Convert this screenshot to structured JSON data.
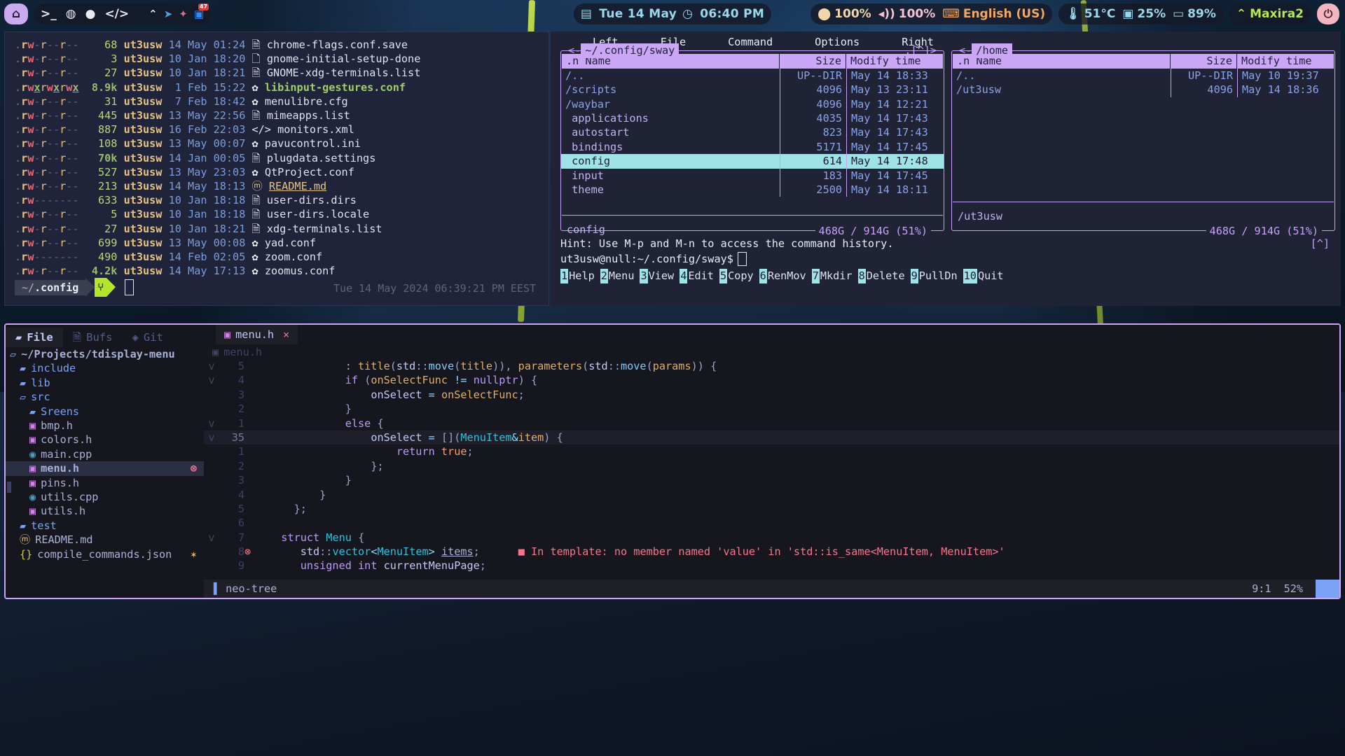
{
  "topbar": {
    "home_icon": "home-icon",
    "launchers": [
      "terminal-icon",
      "browser-icon",
      "chat-icon",
      "code-icon"
    ],
    "tray": [
      "wifi-icon",
      "telegram-icon",
      "bluetooth-icon",
      "zoom-icon"
    ],
    "zoom_badge": "47",
    "clock": {
      "calendar_icon": "calendar-icon",
      "date": "Tue 14 May",
      "clock_icon": "clock-icon",
      "time": "06:40 PM"
    },
    "stats": [
      {
        "name": "brightness",
        "icon": "sun-icon",
        "value": "100%",
        "color": "#f0d6a8"
      },
      {
        "name": "volume",
        "icon": "speaker-icon",
        "value": "100%",
        "color": "#f5c2d2"
      },
      {
        "name": "keyboard-layout",
        "icon": "keyboard-icon",
        "value": "English (US)",
        "color": "#f0a868"
      },
      {
        "name": "temperature",
        "icon": "thermometer-icon",
        "value": "51°C",
        "color": "#9ad7ea"
      },
      {
        "name": "cpu",
        "icon": "cpu-icon",
        "value": "25%",
        "color": "#9ad7ea"
      },
      {
        "name": "battery",
        "icon": "battery-icon",
        "value": "89%",
        "color": "#9ad7ea"
      },
      {
        "name": "network",
        "icon": "wifi-icon",
        "value": "Maxira2",
        "color": "#b5e853"
      }
    ],
    "power_icon": "power-icon"
  },
  "terminal": {
    "prompt_path": "~/.config",
    "prompt_symbol": "⑂",
    "timestamp": "Tue 14 May 2024 06:39:21 PM EEST",
    "files": [
      {
        "perm": ".rw-r--r--",
        "size": "68",
        "size_bold": false,
        "owner": "ut3usw",
        "day": "14",
        "mon": "May",
        "time": "01:24",
        "icon": "file-icon",
        "name": "chrome-flags.conf.save",
        "style": "plain"
      },
      {
        "perm": ".rw-r--r--",
        "size": "3",
        "size_bold": false,
        "owner": "ut3usw",
        "day": "10",
        "mon": "Jan",
        "time": "18:20",
        "icon": "file-outline-icon",
        "name": "gnome-initial-setup-done",
        "style": "plain"
      },
      {
        "perm": ".rw-r--r--",
        "size": "27",
        "size_bold": false,
        "owner": "ut3usw",
        "day": "10",
        "mon": "Jan",
        "time": "18:21",
        "icon": "file-icon",
        "name": "GNOME-xdg-terminals.list",
        "style": "plain"
      },
      {
        "perm": ".rwxrwxrwx",
        "size": "8.9k",
        "size_bold": true,
        "owner": "ut3usw",
        "day": "1",
        "mon": "Feb",
        "time": "15:22",
        "icon": "gear-icon",
        "name": "libinput-gestures.conf",
        "style": "exec"
      },
      {
        "perm": ".rw-r--r--",
        "size": "31",
        "size_bold": false,
        "owner": "ut3usw",
        "day": "7",
        "mon": "Feb",
        "time": "18:42",
        "icon": "gear-icon",
        "name": "menulibre.cfg",
        "style": "plain"
      },
      {
        "perm": ".rw-r--r--",
        "size": "445",
        "size_bold": false,
        "owner": "ut3usw",
        "day": "13",
        "mon": "May",
        "time": "22:56",
        "icon": "file-icon",
        "name": "mimeapps.list",
        "style": "plain"
      },
      {
        "perm": ".rw-r--r--",
        "size": "887",
        "size_bold": false,
        "owner": "ut3usw",
        "day": "16",
        "mon": "Feb",
        "time": "22:03",
        "icon": "code-file-icon",
        "name": "monitors.xml",
        "style": "plain"
      },
      {
        "perm": ".rw-r--r--",
        "size": "108",
        "size_bold": false,
        "owner": "ut3usw",
        "day": "13",
        "mon": "May",
        "time": "00:07",
        "icon": "gear-icon",
        "name": "pavucontrol.ini",
        "style": "plain"
      },
      {
        "perm": ".rw-r--r--",
        "size": "70k",
        "size_bold": true,
        "owner": "ut3usw",
        "day": "14",
        "mon": "Jan",
        "time": "00:05",
        "icon": "file-icon",
        "name": "plugdata.settings",
        "style": "plain"
      },
      {
        "perm": ".rw-r--r--",
        "size": "527",
        "size_bold": false,
        "owner": "ut3usw",
        "day": "13",
        "mon": "May",
        "time": "23:03",
        "icon": "gear-icon",
        "name": "QtProject.conf",
        "style": "plain"
      },
      {
        "perm": ".rw-r--r--",
        "size": "213",
        "size_bold": false,
        "owner": "ut3usw",
        "day": "14",
        "mon": "May",
        "time": "18:13",
        "icon": "markdown-icon",
        "name": "README.md",
        "style": "md"
      },
      {
        "perm": ".rw-------",
        "size": "633",
        "size_bold": false,
        "owner": "ut3usw",
        "day": "10",
        "mon": "Jan",
        "time": "18:18",
        "icon": "file-icon",
        "name": "user-dirs.dirs",
        "style": "plain"
      },
      {
        "perm": ".rw-r--r--",
        "size": "5",
        "size_bold": false,
        "owner": "ut3usw",
        "day": "10",
        "mon": "Jan",
        "time": "18:18",
        "icon": "file-icon",
        "name": "user-dirs.locale",
        "style": "plain"
      },
      {
        "perm": ".rw-r--r--",
        "size": "27",
        "size_bold": false,
        "owner": "ut3usw",
        "day": "10",
        "mon": "Jan",
        "time": "18:21",
        "icon": "file-icon",
        "name": "xdg-terminals.list",
        "style": "plain"
      },
      {
        "perm": ".rw-r--r--",
        "size": "699",
        "size_bold": false,
        "owner": "ut3usw",
        "day": "13",
        "mon": "May",
        "time": "00:08",
        "icon": "gear-icon",
        "name": "yad.conf",
        "style": "plain"
      },
      {
        "perm": ".rw-------",
        "size": "490",
        "size_bold": false,
        "owner": "ut3usw",
        "day": "14",
        "mon": "Feb",
        "time": "02:05",
        "icon": "gear-icon",
        "name": "zoom.conf",
        "style": "plain"
      },
      {
        "perm": ".rw-r--r--",
        "size": "4.2k",
        "size_bold": true,
        "owner": "ut3usw",
        "day": "14",
        "mon": "May",
        "time": "17:13",
        "icon": "gear-icon",
        "name": "zoomus.conf",
        "style": "plain"
      }
    ]
  },
  "mc": {
    "menu": [
      "Left",
      "File",
      "Command",
      "Options",
      "Right"
    ],
    "left_panel": {
      "path": "~/.config/sway",
      "corner_left": "<-",
      "corner_right": ".[^]>",
      "columns": {
        "name": ".n      Name",
        "size": "Size",
        "time": "Modify time"
      },
      "rows": [
        {
          "name": "/..",
          "size": "UP--DIR",
          "time": "May 14 18:33",
          "dir": true,
          "selected": false
        },
        {
          "name": "/scripts",
          "size": "4096",
          "time": "May 13 23:11",
          "dir": true,
          "selected": false
        },
        {
          "name": "/waybar",
          "size": "4096",
          "time": "May 14 12:21",
          "dir": true,
          "selected": false
        },
        {
          "name": " applications",
          "size": "4035",
          "time": "May 14 17:43",
          "dir": false,
          "selected": false
        },
        {
          "name": " autostart",
          "size": "823",
          "time": "May 14 17:43",
          "dir": false,
          "selected": false
        },
        {
          "name": " bindings",
          "size": "5171",
          "time": "May 14 17:45",
          "dir": false,
          "selected": false
        },
        {
          "name": " config",
          "size": "614",
          "time": "May 14 17:48",
          "dir": false,
          "selected": true
        },
        {
          "name": " input",
          "size": "183",
          "time": "May 14 17:45",
          "dir": false,
          "selected": false
        },
        {
          "name": " theme",
          "size": "2500",
          "time": "May 14 18:11",
          "dir": false,
          "selected": false
        }
      ],
      "status": "config",
      "free": "468G / 914G (51%)"
    },
    "right_panel": {
      "path": "/home",
      "corner_left": "<-",
      "corner_right": "",
      "columns": {
        "name": ".n      Name",
        "size": "Size",
        "time": "Modify time"
      },
      "rows": [
        {
          "name": "/..",
          "size": "UP--DIR",
          "time": "May 10 19:37",
          "dir": true,
          "selected": false
        },
        {
          "name": "/ut3usw",
          "size": "4096",
          "time": "May 14 18:36",
          "dir": true,
          "selected": false
        }
      ],
      "status": "/ut3usw",
      "free": "468G / 914G (51%)"
    },
    "hint": "Hint: Use M-p and M-n to access the command history.",
    "hint_right": "[^]",
    "cmdline": "ut3usw@null:~/.config/sway$",
    "fkeys": [
      {
        "num": "1",
        "label": "Help"
      },
      {
        "num": "2",
        "label": "Menu"
      },
      {
        "num": "3",
        "label": "View"
      },
      {
        "num": "4",
        "label": "Edit"
      },
      {
        "num": "5",
        "label": "Copy"
      },
      {
        "num": "6",
        "label": "RenMov"
      },
      {
        "num": "7",
        "label": "Mkdir"
      },
      {
        "num": "8",
        "label": "Delete"
      },
      {
        "num": "9",
        "label": "PullDn"
      },
      {
        "num": "10",
        "label": "Quit"
      }
    ]
  },
  "nvim": {
    "tree_tabs": [
      {
        "icon": "folder-icon",
        "label": "File",
        "active": true
      },
      {
        "icon": "buffer-icon",
        "label": "Bufs",
        "active": false
      },
      {
        "icon": "git-icon",
        "label": "Git",
        "active": false
      }
    ],
    "tree": [
      {
        "indent": 0,
        "icon": "folder-open-icon",
        "label": "~/Projects/tdisplay-menu",
        "kind": "root"
      },
      {
        "indent": 1,
        "icon": "folder-icon",
        "label": "include",
        "kind": "dir"
      },
      {
        "indent": 1,
        "icon": "folder-icon",
        "label": "lib",
        "kind": "dir"
      },
      {
        "indent": 1,
        "icon": "folder-open-icon",
        "label": "src",
        "kind": "dir"
      },
      {
        "indent": 2,
        "icon": "folder-icon",
        "label": "Sreens",
        "kind": "dir"
      },
      {
        "indent": 2,
        "icon": "header-file-icon",
        "label": "bmp.h",
        "kind": "file"
      },
      {
        "indent": 2,
        "icon": "header-file-icon",
        "label": "colors.h",
        "kind": "file"
      },
      {
        "indent": 2,
        "icon": "cpp-file-icon",
        "label": "main.cpp",
        "kind": "file"
      },
      {
        "indent": 2,
        "icon": "header-file-icon",
        "label": "menu.h",
        "kind": "file",
        "selected": true,
        "badge": "error"
      },
      {
        "indent": 2,
        "icon": "header-file-icon",
        "label": "pins.h",
        "kind": "file"
      },
      {
        "indent": 2,
        "icon": "cpp-file-icon",
        "label": "utils.cpp",
        "kind": "file"
      },
      {
        "indent": 2,
        "icon": "header-file-icon",
        "label": "utils.h",
        "kind": "file"
      },
      {
        "indent": 1,
        "icon": "folder-icon",
        "label": "test",
        "kind": "dir"
      },
      {
        "indent": 1,
        "icon": "markdown-icon",
        "label": "README.md",
        "kind": "file"
      },
      {
        "indent": 1,
        "icon": "json-icon",
        "label": "compile_commands.json",
        "kind": "json",
        "badge": "modified"
      }
    ],
    "tab": {
      "icon": "header-file-icon",
      "label": "menu.h",
      "close": "×"
    },
    "winbar": {
      "icon": "header-file-icon",
      "label": "menu.h"
    },
    "code_lines": [
      {
        "fold": "v",
        "num": "5",
        "cur": false,
        "err": false,
        "html": "            : <span class='k-var'>title</span><span class='k-punc'>(</span><span class='k-id'>std</span><span class='k-punc'>::</span><span class='k-mem'>move</span><span class='k-punc'>(</span><span class='k-var'>title</span><span class='k-punc'>)),</span> <span class='k-var'>parameters</span><span class='k-punc'>(</span><span class='k-id'>std</span><span class='k-punc'>::</span><span class='k-mem'>move</span><span class='k-punc'>(</span><span class='k-var'>params</span><span class='k-punc'>))</span> <span class='k-punc'>{</span>"
      },
      {
        "fold": "v",
        "num": "4",
        "cur": false,
        "err": false,
        "html": "            <span class='k-kw'>if</span> <span class='k-punc'>(</span><span class='k-var'>onSelectFunc</span> <span class='k-op'>!=</span> <span class='k-kw'>nullptr</span><span class='k-punc'>)</span> <span class='k-punc'>{</span>"
      },
      {
        "fold": "",
        "num": "3",
        "cur": false,
        "err": false,
        "html": "                <span class='k-id'>onSelect</span> <span class='k-op'>=</span> <span class='k-var'>onSelectFunc</span><span class='k-punc'>;</span>"
      },
      {
        "fold": "",
        "num": "2",
        "cur": false,
        "err": false,
        "html": "            <span class='k-punc'>}</span>"
      },
      {
        "fold": "v",
        "num": "1",
        "cur": false,
        "err": false,
        "html": "            <span class='k-kw'>else</span> <span class='k-punc'>{</span>"
      },
      {
        "fold": "v",
        "num": "35",
        "cur": true,
        "err": false,
        "html": "                <span class='k-id'>onSelect</span> <span class='k-op'>=</span> <span class='k-punc'>[](</span><span class='k-type'>MenuItem</span><span class='k-op'>&amp;</span><span class='k-var'>item</span><span class='k-punc'>)</span> <span class='k-punc'>{</span>"
      },
      {
        "fold": "",
        "num": "1",
        "cur": false,
        "err": false,
        "html": "                    <span class='k-kw'>return</span> <span class='k-bool'>true</span><span class='k-punc'>;</span>"
      },
      {
        "fold": "",
        "num": "2",
        "cur": false,
        "err": false,
        "html": "                <span class='k-punc'>};</span>"
      },
      {
        "fold": "",
        "num": "3",
        "cur": false,
        "err": false,
        "html": "            <span class='k-punc'>}</span>"
      },
      {
        "fold": "",
        "num": "4",
        "cur": false,
        "err": false,
        "html": "        <span class='k-punc'>}</span>"
      },
      {
        "fold": "",
        "num": "5",
        "cur": false,
        "err": false,
        "html": "    <span class='k-punc'>};</span>"
      },
      {
        "fold": "",
        "num": "6",
        "cur": false,
        "err": false,
        "html": ""
      },
      {
        "fold": "v",
        "num": "7",
        "cur": false,
        "err": false,
        "html": "  <span class='k-kw'>struct</span> <span class='k-type'>Menu</span> <span class='k-punc'>{</span>"
      },
      {
        "fold": "",
        "num": "8",
        "cur": false,
        "err": true,
        "html": "     <span class='k-id'>std</span><span class='k-punc'>::</span><span class='k-type'>vector</span><span class='k-op'>&lt;</span><span class='k-type'>MenuItem</span><span class='k-op'>&gt;</span> <span class='k-und'>items</span><span class='k-punc'>;</span>      <span class='diag-sq'>■</span> <span class='diag'>In template: no member named 'value' in 'std::is_same&lt;MenuItem, MenuItem&gt;'</span>"
      },
      {
        "fold": "",
        "num": "9",
        "cur": false,
        "err": false,
        "html": "     <span class='k-kw'>unsigned</span> <span class='k-kw'>int</span> <span class='k-id'>currentMenuPage</span><span class='k-punc'>;</span>"
      }
    ],
    "status": {
      "icon": "tree-icon",
      "name": "neo-tree",
      "position": "9:1",
      "percent": "52%"
    }
  }
}
